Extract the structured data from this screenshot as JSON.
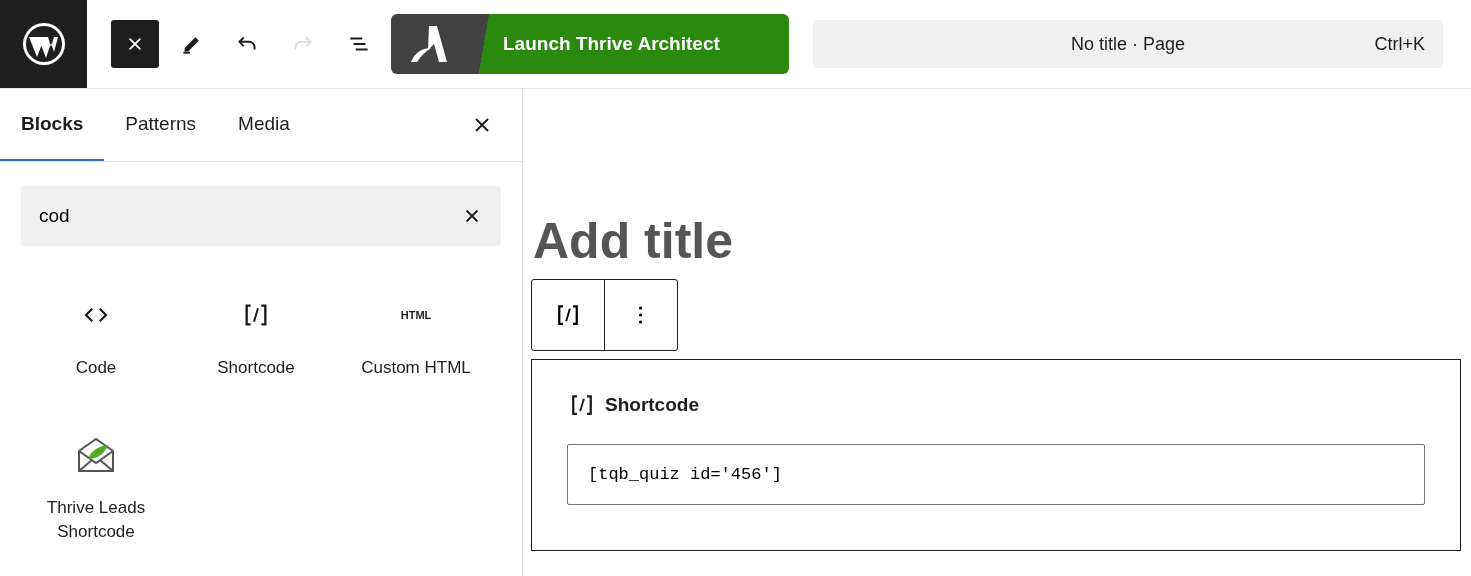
{
  "toolbar": {
    "tools": [
      {
        "kind": "close",
        "disabled": false,
        "active": true
      },
      {
        "kind": "pen",
        "disabled": false,
        "active": false
      },
      {
        "kind": "undo",
        "disabled": false,
        "active": false
      },
      {
        "kind": "redo",
        "disabled": true,
        "active": false
      },
      {
        "kind": "list",
        "disabled": false,
        "active": false
      }
    ],
    "launch_button": "Launch Thrive Architect",
    "command_bar": {
      "title": "No title · Page",
      "shortcut": "Ctrl+K"
    }
  },
  "inserter": {
    "tabs": [
      {
        "label": "Blocks",
        "selected": true
      },
      {
        "label": "Patterns",
        "selected": false
      },
      {
        "label": "Media",
        "selected": false
      }
    ],
    "search": {
      "value": "cod"
    },
    "blocks": [
      {
        "kind": "code",
        "label": "Code"
      },
      {
        "kind": "shortcode",
        "label": "Shortcode"
      },
      {
        "kind": "html",
        "label": "Custom HTML",
        "icon_text": "HTML"
      },
      {
        "kind": "thrive",
        "label": "Thrive Leads Shortcode"
      }
    ]
  },
  "editor": {
    "title_placeholder": "Add title",
    "block": {
      "label": "Shortcode",
      "value": "[tqb_quiz id='456']"
    }
  }
}
